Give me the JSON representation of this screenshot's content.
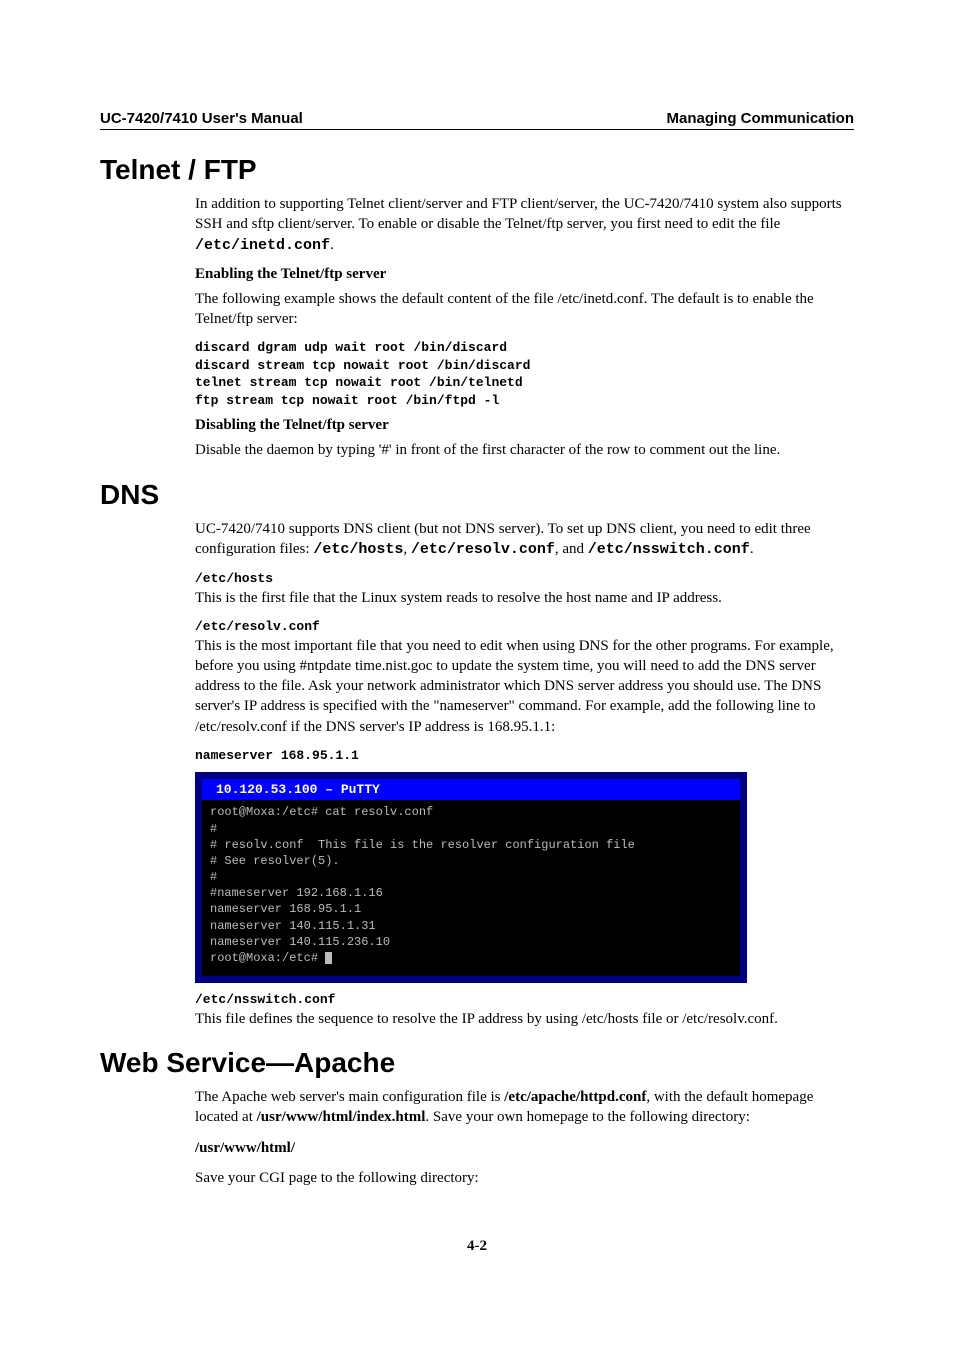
{
  "header": {
    "left": "UC-7420/7410 User's Manual",
    "right": "Managing Communication"
  },
  "section1": {
    "heading": "Telnet / FTP",
    "p1_a": "In addition to supporting Telnet client/server and FTP client/server, the UC-7420/7410 system also supports SSH and sftp client/server. To enable or disable the Telnet/ftp server, you first need to edit the file ",
    "p1_mono": "/etc/inetd.conf",
    "p1_b": ".",
    "sub1": "Enabling the Telnet/ftp server",
    "p2": "The following example shows the default content of the file /etc/inetd.conf. The default is to enable the Telnet/ftp server:",
    "code": "discard dgram udp wait root /bin/discard\ndiscard stream tcp nowait root /bin/discard\ntelnet stream tcp nowait root /bin/telnetd\nftp stream tcp nowait root /bin/ftpd -l",
    "sub2": "Disabling the Telnet/ftp server",
    "p3": "Disable the daemon by typing '#' in front of the first character of the row to comment out the line."
  },
  "section2": {
    "heading": "DNS",
    "p1_a": "UC-7420/7410 supports DNS client (but not DNS server). To set up DNS client, you need to edit three configuration files: ",
    "p1_m1": "/etc/hosts",
    "p1_sep1": ", ",
    "p1_m2": "/etc/resolv.conf",
    "p1_sep2": ", and ",
    "p1_m3": "/etc/nsswitch.conf",
    "p1_b": ".",
    "f1": "/etc/hosts",
    "p2": "This is the first file that the Linux system reads to resolve the host name and IP address.",
    "f2": "/etc/resolv.conf",
    "p3": "This is the most important file that you need to edit when using DNS for the other programs. For example, before you using #ntpdate time.nist.goc to update the system time, you will need to add the DNS server address to the file. Ask your network administrator which DNS server address you should use. The DNS server's IP address is specified with the \"nameserver\" command. For example, add the following line to /etc/resolv.conf if the DNS server's IP address is 168.95.1.1:",
    "code": "nameserver 168.95.1.1",
    "terminal": {
      "title": "10.120.53.100 – PuTTY",
      "body": "root@Moxa:/etc# cat resolv.conf\n#\n# resolv.conf  This file is the resolver configuration file\n# See resolver(5).\n#\n#nameserver 192.168.1.16\nnameserver 168.95.1.1\nnameserver 140.115.1.31\nnameserver 140.115.236.10\nroot@Moxa:/etc# "
    },
    "f3": "/etc/nsswitch.conf",
    "p4": "This file defines the sequence to resolve the IP address by using /etc/hosts file or /etc/resolv.conf."
  },
  "section3": {
    "heading": "Web Service—Apache",
    "p1_a": "The Apache web server's main configuration file is ",
    "p1_b": "/etc/apache/httpd.conf",
    "p1_c": ", with the default homepage located at ",
    "p1_d": "/usr/www/html/index.html",
    "p1_e": ". Save your own homepage to the following directory:",
    "path": "/usr/www/html/",
    "p2": "Save your CGI page to the following directory:"
  },
  "pagenum": "4-2"
}
